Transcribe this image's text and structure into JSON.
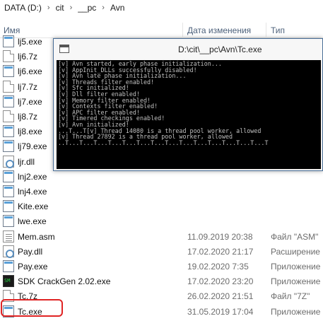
{
  "breadcrumb": {
    "parts": [
      "DATA (D:)",
      "cit",
      "__pc",
      "Avn"
    ],
    "separator": "›"
  },
  "columns": {
    "name": "Имя",
    "date": "Дата изменения",
    "type": "Тип"
  },
  "files": [
    {
      "name": "lj5.exe",
      "icon": "exe-icon",
      "date": "",
      "type": ""
    },
    {
      "name": "lj6.7z",
      "icon": "archive-icon",
      "date": "",
      "type": ""
    },
    {
      "name": "lj6.exe",
      "icon": "exe-icon",
      "date": "",
      "type": ""
    },
    {
      "name": "lj7.7z",
      "icon": "archive-icon",
      "date": "",
      "type": ""
    },
    {
      "name": "lj7.exe",
      "icon": "exe-icon",
      "date": "",
      "type": ""
    },
    {
      "name": "lj8.7z",
      "icon": "archive-icon",
      "date": "",
      "type": ""
    },
    {
      "name": "lj8.exe",
      "icon": "exe-icon",
      "date": "",
      "type": ""
    },
    {
      "name": "lj79.exe",
      "icon": "exe-icon",
      "date": "",
      "type": ""
    },
    {
      "name": "ljr.dll",
      "icon": "dll-icon",
      "date": "",
      "type": ""
    },
    {
      "name": "lnj2.exe",
      "icon": "exe-icon",
      "date": "",
      "type": ""
    },
    {
      "name": "lnj4.exe",
      "icon": "exe-icon",
      "date": "",
      "type": ""
    },
    {
      "name": "Kite.exe",
      "icon": "exe-icon",
      "date": "",
      "type": ""
    },
    {
      "name": "lwe.exe",
      "icon": "exe-icon",
      "date": "",
      "type": ""
    },
    {
      "name": "Mem.asm",
      "icon": "asm-file-icon",
      "date": "11.09.2019 20:38",
      "type": "Файл \"ASM\""
    },
    {
      "name": "Pay.dll",
      "icon": "dll-icon",
      "date": "17.02.2020 21:17",
      "type": "Расширение"
    },
    {
      "name": "Pay.exe",
      "icon": "exe-icon",
      "date": "19.02.2020 7:35",
      "type": "Приложение"
    },
    {
      "name": "SDK CrackGen 2.02.exe",
      "icon": "crackgen-app-icon",
      "date": "17.02.2020 23:20",
      "type": "Приложение"
    },
    {
      "name": "Tc.7z",
      "icon": "archive-icon",
      "date": "26.02.2020 21:51",
      "type": "Файл \"7Z\""
    },
    {
      "name": "Tc.exe",
      "icon": "exe-icon",
      "date": "31.05.2019 17:04",
      "type": "Приложение"
    }
  ],
  "console": {
    "title": "D:\\cit\\__pc\\Avn\\Tc.exe",
    "lines": [
      "[v] Avn started, early phase initialization...",
      "[v] AppInit_DLLs successfully disabled!",
      "[v] Avn late phase initialization...",
      "[v] Threads filter enabled!",
      "[v] Sfc initialized!",
      "[v] Dll filter enabled!",
      "[v] Memory filter enabled!",
      "[v] Contexts filter enabled!",
      "[v] APC filter enabled!",
      "[v] Timered checkings enabled!",
      "[v] Avn initialized!",
      "...T...T[v] Thread 14080 is a thread pool worker, allowed",
      "[v] Thread 27892 is a thread pool worker, allowed",
      "..T...T...T...T...T...T...T...T...T...T...T...T...T...T...T"
    ]
  },
  "colors": {
    "highlight": "#e02424",
    "console_bg": "#000000",
    "console_text": "#c0c0c0",
    "header_text": "#4c607a"
  }
}
